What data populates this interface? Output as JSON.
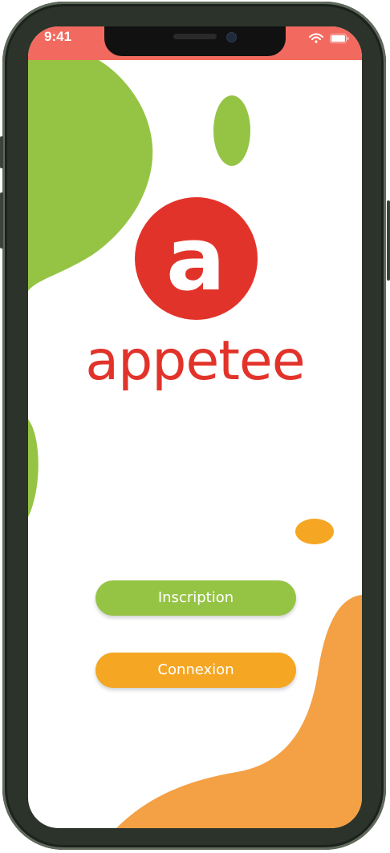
{
  "status_bar": {
    "time": "9:41",
    "background": "#f26a5f"
  },
  "brand": {
    "name": "appetee",
    "mark_letter": "a",
    "color": "#e2332a"
  },
  "actions": {
    "signup_label": "Inscription",
    "login_label": "Connexion"
  },
  "colors": {
    "green": "#95c445",
    "orange": "#f5a623",
    "red": "#e2332a"
  },
  "icons": [
    "wifi-icon",
    "battery-icon",
    "camera-icon"
  ]
}
